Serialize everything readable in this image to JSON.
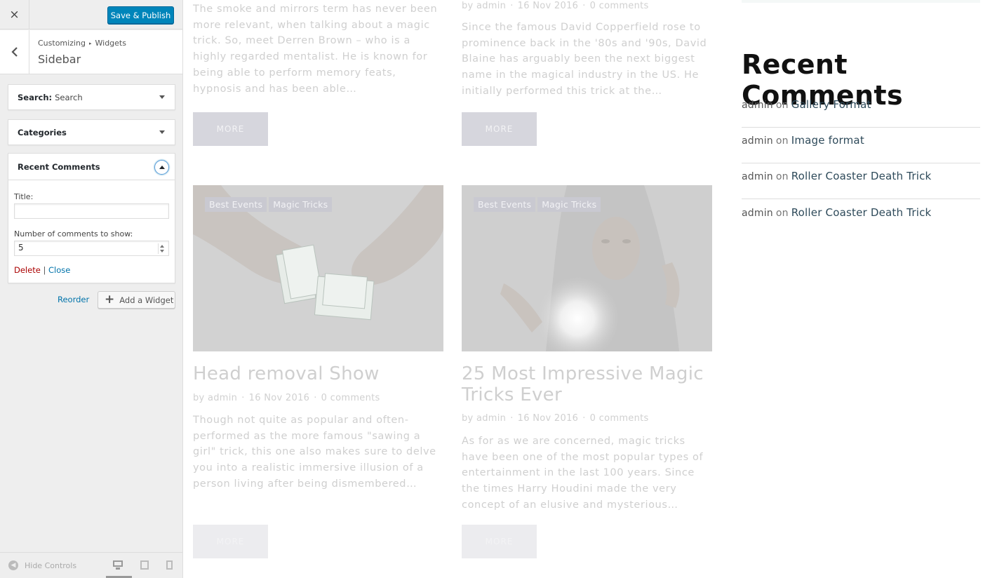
{
  "customizer": {
    "close_icon": "×",
    "save_label": "Save & Publish",
    "breadcrumb": {
      "root": "Customizing",
      "sep": "▸",
      "section": "Widgets"
    },
    "section_title": "Sidebar",
    "widgets": [
      {
        "name": "Search:",
        "subtitle": "Search"
      },
      {
        "name": "Categories",
        "subtitle": ""
      },
      {
        "name": "Recent Comments",
        "subtitle": ""
      }
    ],
    "recent_comments_form": {
      "title_label": "Title:",
      "title_value": "",
      "count_label": "Number of comments to show:",
      "count_value": "5",
      "delete_label": "Delete",
      "separator": "|",
      "close_label": "Close"
    },
    "reorder_label": "Reorder",
    "add_widget_label": "Add a Widget",
    "add_widget_icon": "+",
    "footer": {
      "hide_controls_label": "Hide Controls",
      "devices": [
        "desktop-icon",
        "tablet-icon",
        "mobile-icon"
      ],
      "active_device": "desktop"
    },
    "accent_color": "#0085ba"
  },
  "preview": {
    "posts_top": [
      {
        "excerpt": "The smoke and mirrors term has never been more relevant, when talking about a magic trick. So, meet Derren Brown – who is a highly regarded mentalist. He is known for being able to perform memory feats, hypnosis and has been able…",
        "more_label": "MORE"
      },
      {
        "meta": {
          "by": "by",
          "author": "admin",
          "date": "16 Nov 2016",
          "comments": "0 comments"
        },
        "excerpt": "Since the famous David Copperfield rose to prominence back in the '80s and '90s, David Blaine has arguably been the next biggest name in the magical industry in the US. He initially performed this trick at the…",
        "more_label": "MORE"
      }
    ],
    "posts_bottom": [
      {
        "tags": [
          "Best Events",
          "Magic Tricks"
        ],
        "image": "cards-hands-image",
        "title": "Head removal Show",
        "meta": {
          "by": "by",
          "author": "admin",
          "date": "16 Nov 2016",
          "comments": "0 comments"
        },
        "excerpt": "Though not quite as popular and often-performed as the more famous \"sawing a girl\" trick, this one also makes sure to delve you into a realistic immersive illusion of a person living after being dismembered…",
        "more_label": "MORE"
      },
      {
        "tags": [
          "Best Events",
          "Magic Tricks"
        ],
        "image": "magician-sparkles-image",
        "title": "25 Most Impressive Magic Tricks Ever",
        "meta": {
          "by": "by",
          "author": "admin",
          "date": "16 Nov 2016",
          "comments": "0 comments"
        },
        "excerpt": "As for as we are concerned, magic tricks have been one of the most popular types of entertainment in the last 100 years. Since the times Harry Houdini made the very concept of an elusive and mysterious…",
        "more_label": "MORE"
      }
    ],
    "recent_comments": {
      "title": "Recent Comments",
      "on_word": "on",
      "items": [
        {
          "author": "admin",
          "post": "Gallery Format"
        },
        {
          "author": "admin",
          "post": "Image format"
        },
        {
          "author": "admin",
          "post": "Roller Coaster Death Trick"
        },
        {
          "author": "admin",
          "post": "Roller Coaster Death Trick"
        }
      ]
    }
  }
}
